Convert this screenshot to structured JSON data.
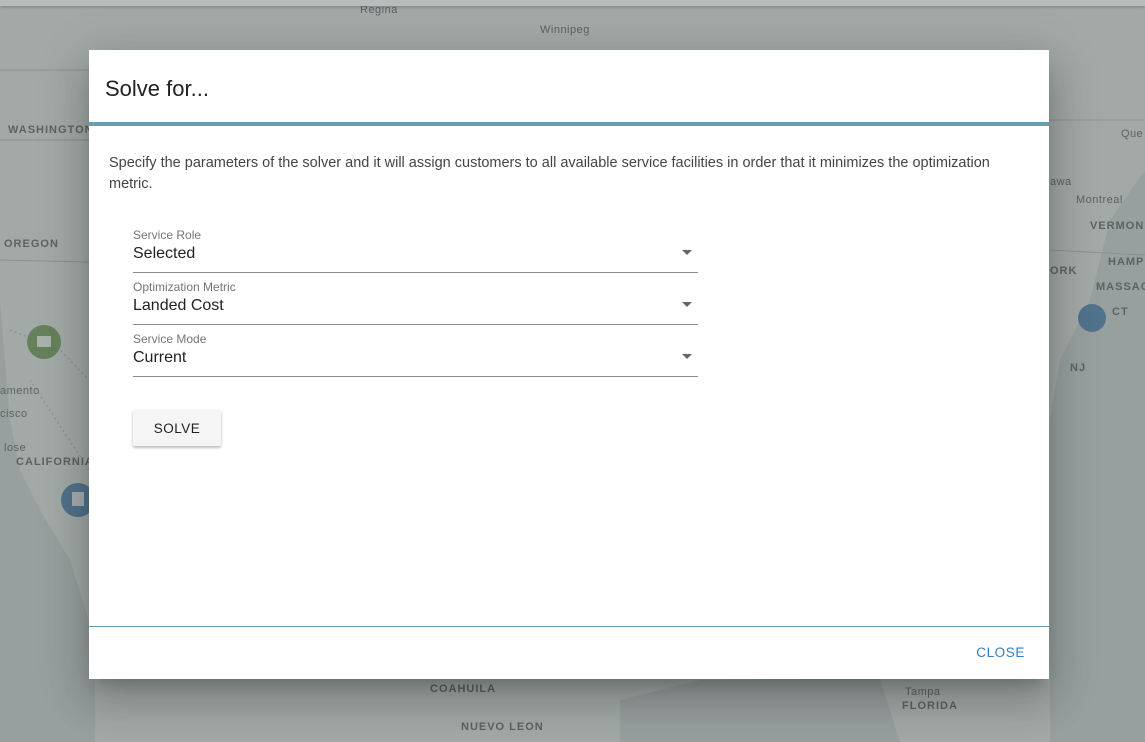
{
  "map": {
    "labels": [
      {
        "key": "regina",
        "text": "Regina"
      },
      {
        "key": "winnipeg",
        "text": "Winnipeg"
      },
      {
        "key": "washington",
        "text": "WASHINGTON"
      },
      {
        "key": "oregon",
        "text": "OREGON"
      },
      {
        "key": "sacramento",
        "text": "amento"
      },
      {
        "key": "sanfrancisco",
        "text": "cisco"
      },
      {
        "key": "sanjose",
        "text": "lose"
      },
      {
        "key": "california",
        "text": "CALIFORNIA"
      },
      {
        "key": "coahuila",
        "text": "COAHUILA"
      },
      {
        "key": "nuevoleon",
        "text": "NUEVO LEON"
      },
      {
        "key": "ottawa",
        "text": "awa"
      },
      {
        "key": "montreal",
        "text": "Montreal"
      },
      {
        "key": "quebec",
        "text": "Que"
      },
      {
        "key": "vermont",
        "text": "VERMON"
      },
      {
        "key": "newhampshire",
        "text": "HAMP"
      },
      {
        "key": "newyork",
        "text": "ORK"
      },
      {
        "key": "massachusetts",
        "text": "MASSAC"
      },
      {
        "key": "connecticut",
        "text": "CT"
      },
      {
        "key": "nj",
        "text": "NJ"
      },
      {
        "key": "tampa",
        "text": "Tampa"
      },
      {
        "key": "florida",
        "text": "FLORIDA"
      }
    ],
    "colors": {
      "water": "#c9d2d2",
      "land": "#e3e6e3",
      "marker_green": "#7fa56a",
      "marker_blue": "#5e8fb5"
    }
  },
  "dialog": {
    "title": "Solve for...",
    "description": "Specify the parameters of the solver and it will assign customers to all available service facilities in order that it minimizes the optimization metric.",
    "fields": {
      "service_role": {
        "label": "Service Role",
        "value": "Selected"
      },
      "optimization_metric": {
        "label": "Optimization Metric",
        "value": "Landed Cost"
      },
      "service_mode": {
        "label": "Service Mode",
        "value": "Current"
      }
    },
    "solve_label": "SOLVE",
    "close_label": "CLOSE",
    "accent_color": "#6a9fb1",
    "close_color": "#2f7fc9"
  }
}
